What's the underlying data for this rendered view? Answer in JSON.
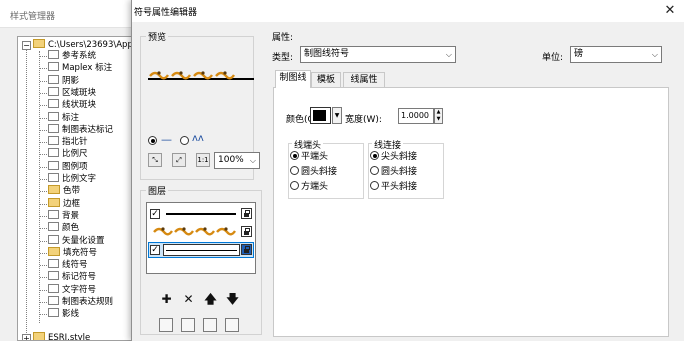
{
  "style_manager": {
    "title": "样式管理器",
    "tree": {
      "root_label": "C:\\Users\\23693\\App",
      "items": [
        {
          "label": "参考系统",
          "type": "file"
        },
        {
          "label": "Maplex 标注",
          "type": "file"
        },
        {
          "label": "阴影",
          "type": "file"
        },
        {
          "label": "区域斑块",
          "type": "file"
        },
        {
          "label": "线状斑块",
          "type": "file"
        },
        {
          "label": "标注",
          "type": "file"
        },
        {
          "label": "制图表达标记",
          "type": "file"
        },
        {
          "label": "指北针",
          "type": "file"
        },
        {
          "label": "比例尺",
          "type": "file"
        },
        {
          "label": "图例项",
          "type": "file"
        },
        {
          "label": "比例文字",
          "type": "file"
        },
        {
          "label": "色带",
          "type": "folder"
        },
        {
          "label": "边框",
          "type": "folder"
        },
        {
          "label": "背景",
          "type": "file"
        },
        {
          "label": "颜色",
          "type": "file"
        },
        {
          "label": "矢量化设置",
          "type": "file"
        },
        {
          "label": "填充符号",
          "type": "folder"
        },
        {
          "label": "线符号",
          "type": "file"
        },
        {
          "label": "标记符号",
          "type": "file"
        },
        {
          "label": "文字符号",
          "type": "file"
        },
        {
          "label": "制图表达规则",
          "type": "file"
        },
        {
          "label": "影线",
          "type": "file"
        }
      ],
      "last_label": "ESRI.style"
    }
  },
  "dialog": {
    "title": "符号属性编辑器",
    "close_glyph": "✕",
    "preview": {
      "label": "预览",
      "radio1_glyph": "—",
      "radio2_glyph": "ʌʌ",
      "zoom": "100%",
      "btn_fit": "⛶",
      "btn_full": "⛶",
      "btn_actual": "1:1"
    },
    "layers": {
      "label": "图层",
      "tool_add": "✚",
      "tool_delete": "✕",
      "tool_up": "🡅",
      "tool_down": "🡇"
    },
    "properties": {
      "label": "属性:",
      "type_label": "类型:",
      "type_value": "制图线符号",
      "unit_label": "单位:",
      "unit_value": "磅",
      "tabs": [
        "制图线",
        "模板",
        "线属性"
      ],
      "color_label": "颜色(C):",
      "color_value": "#000000",
      "width_label": "宽度(W):",
      "width_value": "1.0000",
      "line_caps": {
        "label": "线端头",
        "options": [
          "平端头",
          "圆头斜接",
          "方端头"
        ],
        "selected_index": 0
      },
      "line_joins": {
        "label": "线连接",
        "options": [
          "尖头斜接",
          "圆头斜接",
          "平头斜接"
        ],
        "selected_index": 0
      }
    }
  },
  "icons": {
    "add": "plus-icon",
    "delete": "x-icon",
    "move_up": "arrow-up-icon",
    "move_down": "arrow-down-icon",
    "lock": "lock-icon"
  },
  "colors": {
    "accent_select": "#0078d7",
    "pattern_orange": "#d68a12",
    "pattern_dark": "#5a3a0c"
  }
}
